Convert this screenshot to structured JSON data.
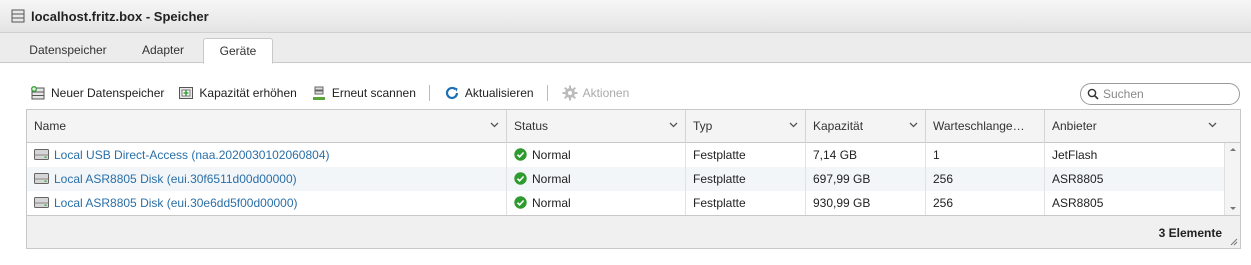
{
  "window": {
    "title": "localhost.fritz.box - Speicher"
  },
  "tabs": [
    {
      "label": "Datenspeicher"
    },
    {
      "label": "Adapter"
    },
    {
      "label": "Geräte"
    }
  ],
  "active_tab": "Geräte",
  "toolbar": {
    "new_datastore": "Neuer Datenspeicher",
    "increase_capacity": "Kapazität erhöhen",
    "rescan": "Erneut scannen",
    "refresh": "Aktualisieren",
    "actions": "Aktionen"
  },
  "search": {
    "placeholder": "Suchen",
    "value": ""
  },
  "table": {
    "columns": [
      "Name",
      "Status",
      "Typ",
      "Kapazität",
      "Warteschlange…",
      "Anbieter"
    ],
    "rows": [
      {
        "name": "Local USB Direct-Access (naa.2020030102060804)",
        "status": "Normal",
        "type": "Festplatte",
        "capacity": "7,14 GB",
        "queue": "1",
        "vendor": "JetFlash"
      },
      {
        "name": "Local ASR8805 Disk (eui.30f6511d00d00000)",
        "status": "Normal",
        "type": "Festplatte",
        "capacity": "697,99 GB",
        "queue": "256",
        "vendor": "ASR8805"
      },
      {
        "name": "Local ASR8805 Disk (eui.30e6dd5f00d00000)",
        "status": "Normal",
        "type": "Festplatte",
        "capacity": "930,99 GB",
        "queue": "256",
        "vendor": "ASR8805"
      }
    ],
    "footer_count": "3 Elemente"
  },
  "colors": {
    "status_ok": "#2e9b2e",
    "link": "#2a6fa8",
    "refresh_icon": "#1f6fb5"
  }
}
